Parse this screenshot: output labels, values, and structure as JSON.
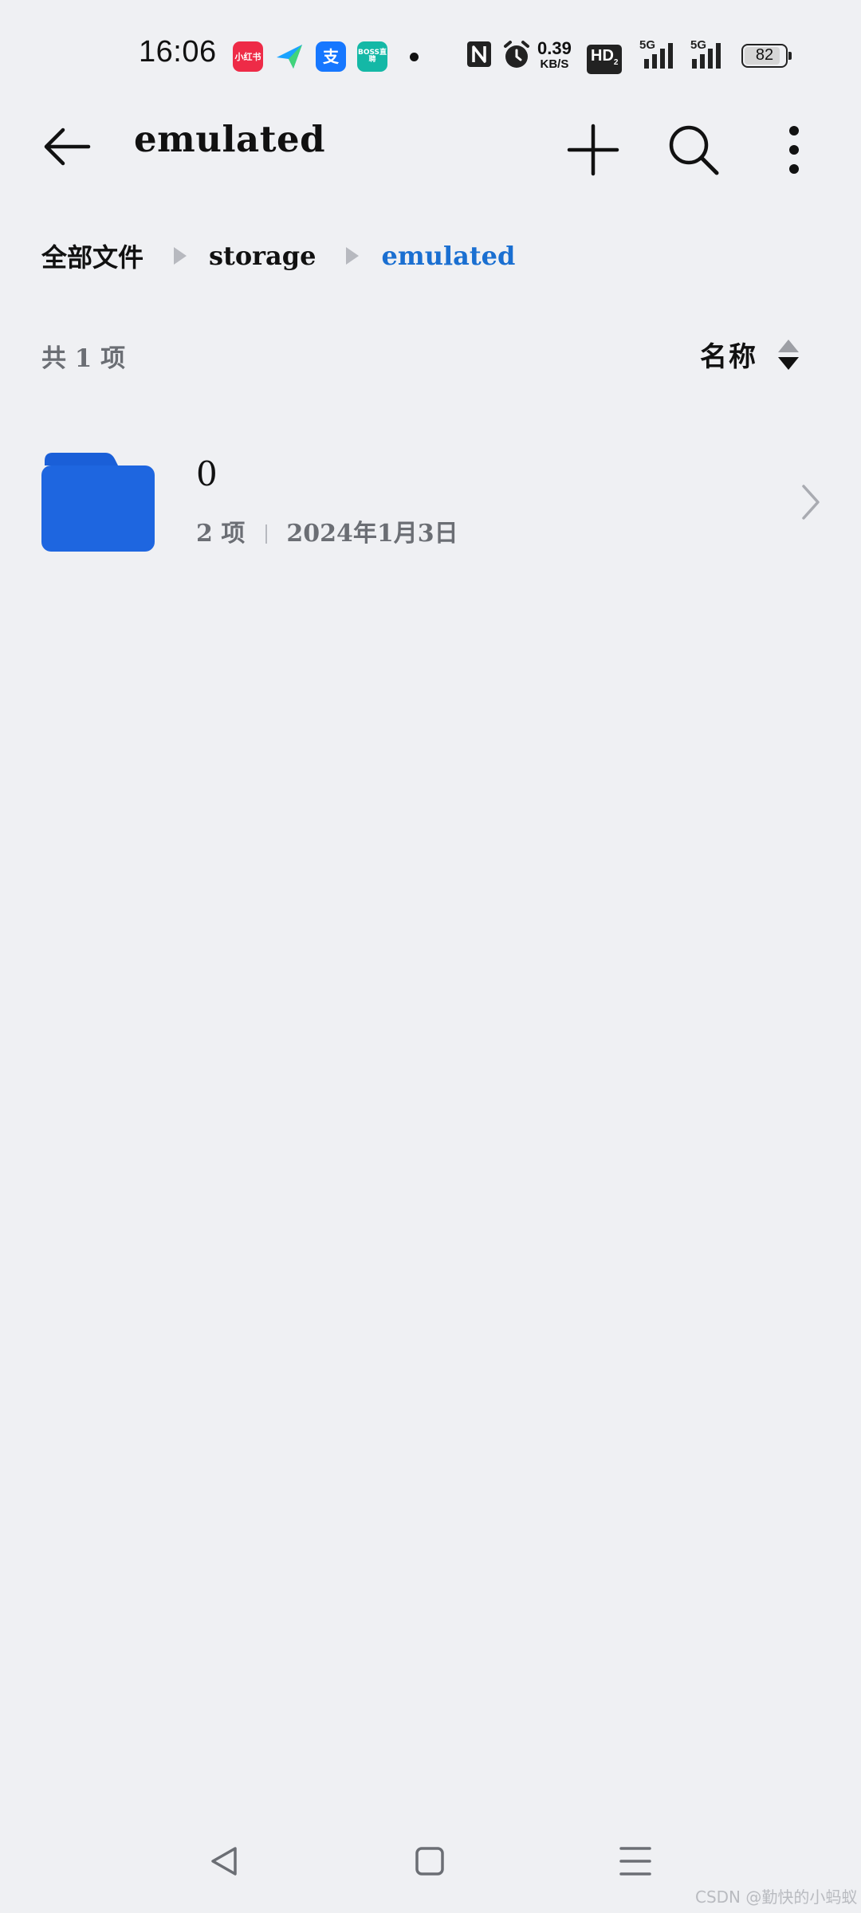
{
  "status_bar": {
    "time": "16:06",
    "apps": [
      {
        "name": "xiaohongshu",
        "label": "小红书"
      },
      {
        "name": "paper-plane",
        "label": ""
      },
      {
        "name": "alipay",
        "label": "支"
      },
      {
        "name": "boss",
        "label": "BOSS直聘"
      }
    ],
    "net_speed_value": "0.39",
    "net_speed_unit": "KB/S",
    "hd_label": "HD",
    "signal_label_1": "5G",
    "signal_label_2": "5G",
    "battery_level": "82"
  },
  "app_bar": {
    "title": "emulated",
    "icons": [
      "arrow-left-icon",
      "plus-icon",
      "search-icon",
      "more-vertical-icon"
    ]
  },
  "breadcrumb": {
    "items": [
      "全部文件",
      "storage",
      "emulated"
    ]
  },
  "list_header": {
    "count": "共 1 项",
    "sort_label": "名称"
  },
  "files": [
    {
      "name": "0",
      "items": "2 项",
      "date": "2024年1月3日",
      "icon": "folder-icon"
    }
  ],
  "nav_bar": {
    "icons": [
      "triangle-back-icon",
      "square-home-icon",
      "lines-menu-icon"
    ]
  },
  "watermark": "CSDN @勤快的小蚂蚁",
  "colors": {
    "background": "#eff0f3",
    "accent": "#1a6fd1",
    "folder": "#1e66e0",
    "secondary_text": "#6b6e74"
  }
}
